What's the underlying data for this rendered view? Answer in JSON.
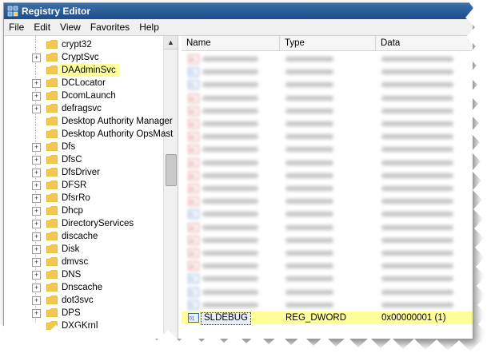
{
  "window": {
    "title": "Registry Editor"
  },
  "menu": [
    {
      "label": "File"
    },
    {
      "label": "Edit"
    },
    {
      "label": "View"
    },
    {
      "label": "Favorites"
    },
    {
      "label": "Help"
    }
  ],
  "tree": {
    "items": [
      {
        "label": "crypt32",
        "expandable": false,
        "selected": false
      },
      {
        "label": "CryptSvc",
        "expandable": true,
        "selected": false
      },
      {
        "label": "DAAdminSvc",
        "expandable": false,
        "selected": true
      },
      {
        "label": "DCLocator",
        "expandable": true,
        "selected": false
      },
      {
        "label": "DcomLaunch",
        "expandable": true,
        "selected": false
      },
      {
        "label": "defragsvc",
        "expandable": true,
        "selected": false
      },
      {
        "label": "Desktop Authority Manager",
        "expandable": false,
        "selected": false
      },
      {
        "label": "Desktop Authority OpsMast",
        "expandable": false,
        "selected": false
      },
      {
        "label": "Dfs",
        "expandable": true,
        "selected": false
      },
      {
        "label": "DfsC",
        "expandable": true,
        "selected": false
      },
      {
        "label": "DfsDriver",
        "expandable": true,
        "selected": false
      },
      {
        "label": "DFSR",
        "expandable": true,
        "selected": false
      },
      {
        "label": "DfsrRo",
        "expandable": true,
        "selected": false
      },
      {
        "label": "Dhcp",
        "expandable": true,
        "selected": false
      },
      {
        "label": "DirectoryServices",
        "expandable": true,
        "selected": false
      },
      {
        "label": "discache",
        "expandable": true,
        "selected": false
      },
      {
        "label": "Disk",
        "expandable": true,
        "selected": false
      },
      {
        "label": "dmvsc",
        "expandable": true,
        "selected": false
      },
      {
        "label": "DNS",
        "expandable": true,
        "selected": false
      },
      {
        "label": "Dnscache",
        "expandable": true,
        "selected": false
      },
      {
        "label": "dot3svc",
        "expandable": true,
        "selected": false
      },
      {
        "label": "DPS",
        "expandable": true,
        "selected": false
      },
      {
        "label": "DXGKrnl",
        "expandable": false,
        "selected": false
      }
    ]
  },
  "list": {
    "columns": [
      {
        "label": "Name"
      },
      {
        "label": "Type"
      },
      {
        "label": "Data"
      }
    ],
    "rows": [
      {
        "name": "",
        "type": "",
        "data": "",
        "blurred": true,
        "icon": "string"
      },
      {
        "name": "",
        "type": "",
        "data": "",
        "blurred": true,
        "icon": "dword"
      },
      {
        "name": "",
        "type": "",
        "data": "",
        "blurred": true,
        "icon": "dword"
      },
      {
        "name": "",
        "type": "",
        "data": "",
        "blurred": true,
        "icon": "string"
      },
      {
        "name": "",
        "type": "",
        "data": "",
        "blurred": true,
        "icon": "string"
      },
      {
        "name": "",
        "type": "",
        "data": "",
        "blurred": true,
        "icon": "string"
      },
      {
        "name": "",
        "type": "",
        "data": "",
        "blurred": true,
        "icon": "string"
      },
      {
        "name": "",
        "type": "",
        "data": "",
        "blurred": true,
        "icon": "string"
      },
      {
        "name": "",
        "type": "",
        "data": "",
        "blurred": true,
        "icon": "string"
      },
      {
        "name": "",
        "type": "",
        "data": "",
        "blurred": true,
        "icon": "string"
      },
      {
        "name": "",
        "type": "",
        "data": "",
        "blurred": true,
        "icon": "string"
      },
      {
        "name": "",
        "type": "",
        "data": "",
        "blurred": true,
        "icon": "string"
      },
      {
        "name": "",
        "type": "",
        "data": "",
        "blurred": true,
        "icon": "dword"
      },
      {
        "name": "",
        "type": "",
        "data": "",
        "blurred": true,
        "icon": "string"
      },
      {
        "name": "",
        "type": "",
        "data": "",
        "blurred": true,
        "icon": "string"
      },
      {
        "name": "",
        "type": "",
        "data": "",
        "blurred": true,
        "icon": "string"
      },
      {
        "name": "",
        "type": "",
        "data": "",
        "blurred": true,
        "icon": "string"
      },
      {
        "name": "",
        "type": "",
        "data": "",
        "blurred": true,
        "icon": "dword"
      },
      {
        "name": "",
        "type": "",
        "data": "",
        "blurred": true,
        "icon": "dword"
      },
      {
        "name": "",
        "type": "",
        "data": "",
        "blurred": true,
        "icon": "dword"
      },
      {
        "name": "SLDEBUG",
        "type": "REG_DWORD",
        "data": "0x00000001 (1)",
        "blurred": false,
        "icon": "dword",
        "highlight": true
      }
    ]
  },
  "colors": {
    "selection_highlight": "#ffff99",
    "folder": "#f2c94c",
    "title_bar": "#2a5f99"
  }
}
